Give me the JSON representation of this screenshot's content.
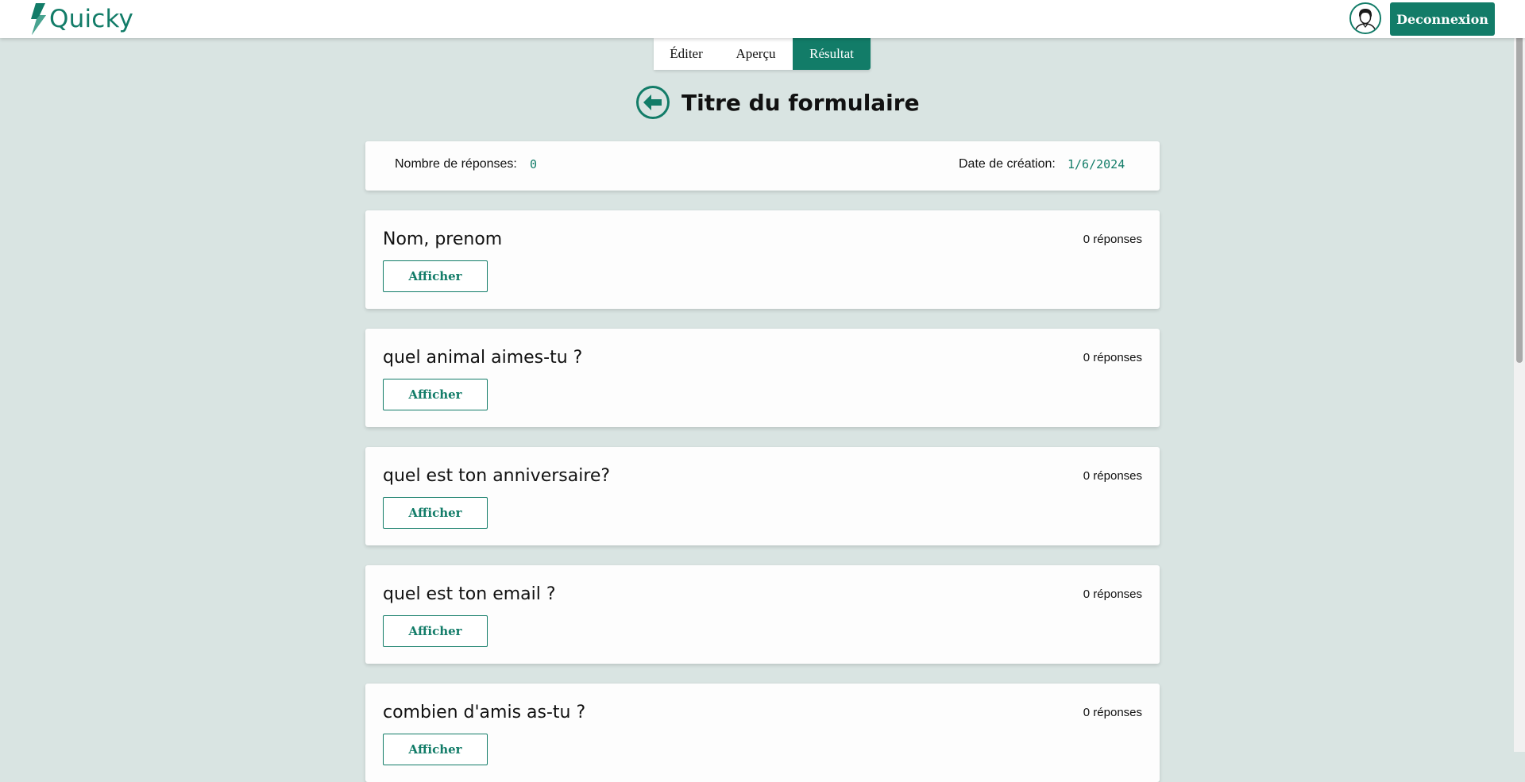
{
  "header": {
    "logo_text": "Quicky",
    "logout_label": "Deconnexion",
    "brand_color": "#127c68"
  },
  "tabs": [
    {
      "label": "Éditer",
      "active": false
    },
    {
      "label": "Aperçu",
      "active": false
    },
    {
      "label": "Résultat",
      "active": true
    }
  ],
  "page": {
    "title": "Titre du formulaire"
  },
  "info": {
    "responses_label": "Nombre de réponses:",
    "responses_value": "0",
    "date_label": "Date de création:",
    "date_value": "1/6/2024"
  },
  "questions": [
    {
      "title": "Nom, prenom",
      "count": "0 réponses",
      "button": "Afficher"
    },
    {
      "title": "quel animal aimes-tu ?",
      "count": "0 réponses",
      "button": "Afficher"
    },
    {
      "title": "quel est ton anniversaire?",
      "count": "0 réponses",
      "button": "Afficher"
    },
    {
      "title": "quel est ton email ?",
      "count": "0 réponses",
      "button": "Afficher"
    },
    {
      "title": "combien d'amis as-tu ?",
      "count": "0 réponses",
      "button": "Afficher"
    }
  ]
}
